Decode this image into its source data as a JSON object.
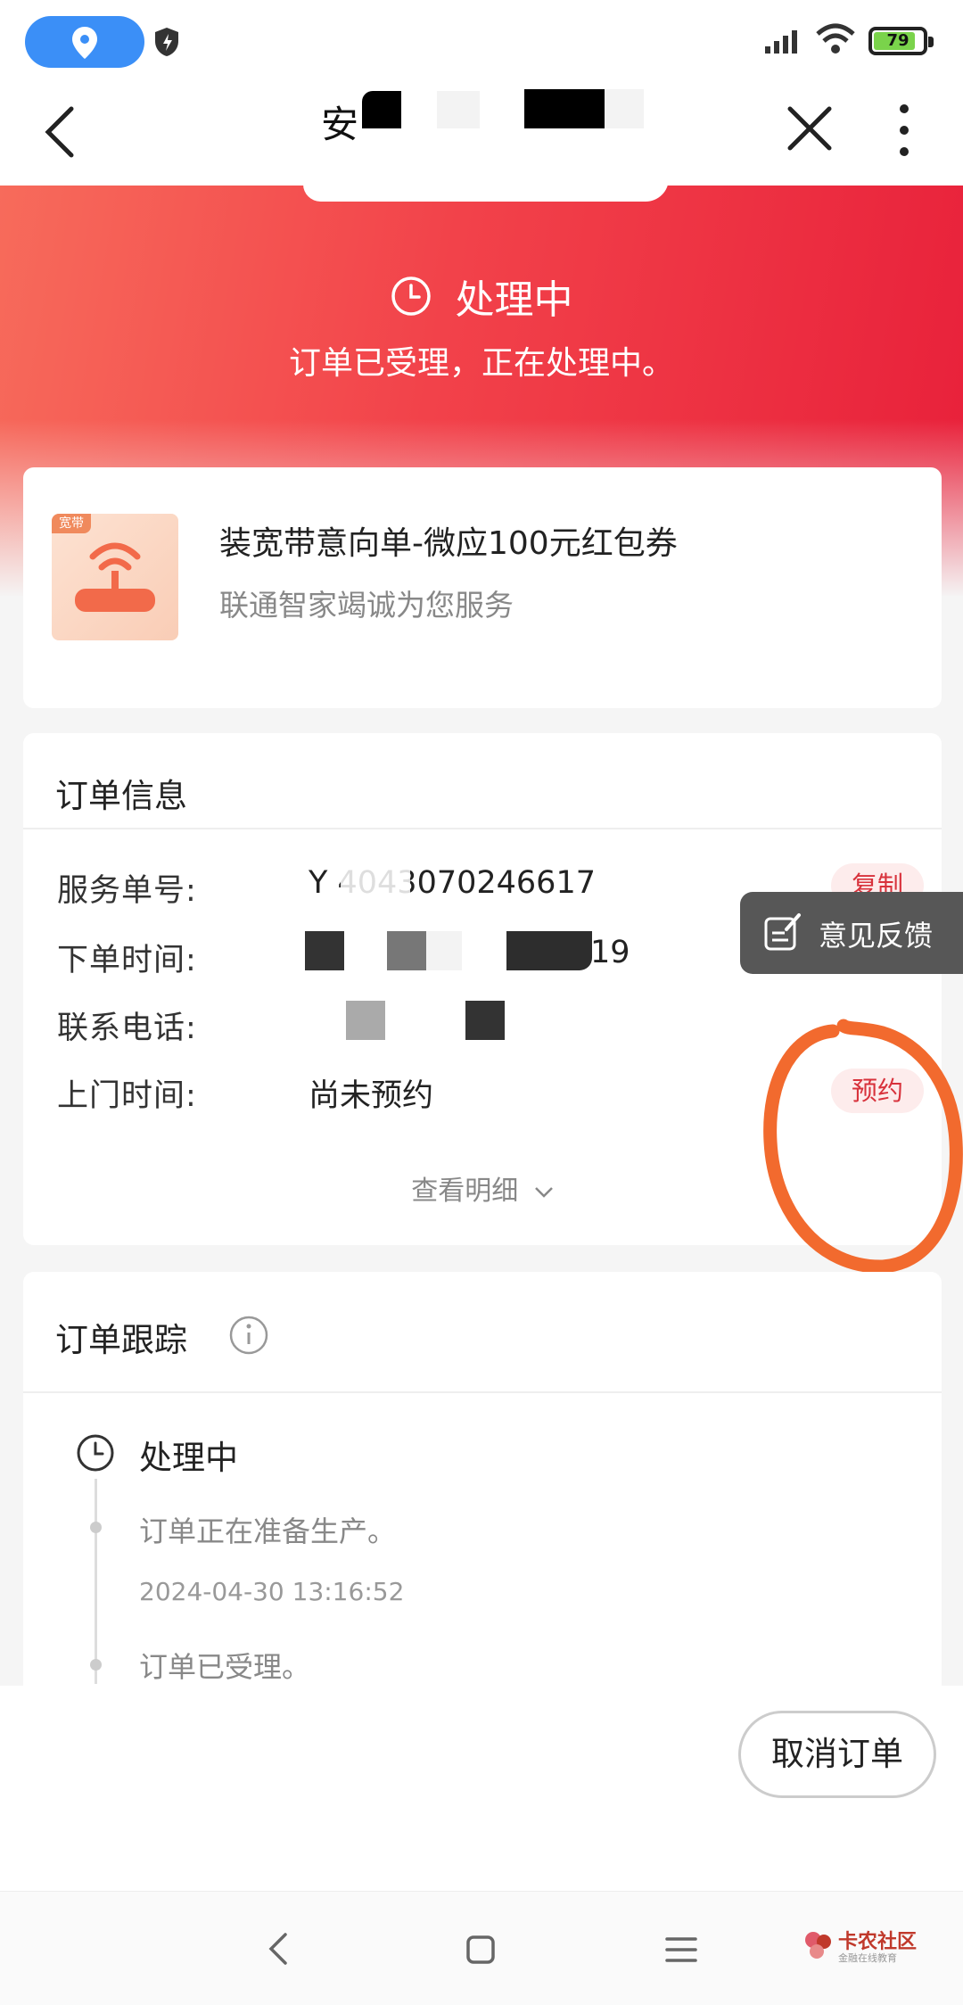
{
  "status_bar": {
    "battery": "79"
  },
  "header": {
    "title_partial": "安"
  },
  "hero": {
    "status_title": "处理中",
    "status_desc": "订单已受理，正在处理中。"
  },
  "product": {
    "tag": "宽带",
    "name": "装宽带意向单-微应100元红包券",
    "subtitle": "联通智家竭诚为您服务"
  },
  "order_info": {
    "title": "订单信息",
    "rows": [
      {
        "label": "服务单号:",
        "value": "Y    4043070246617",
        "action": "复制"
      },
      {
        "label": "下单时间:",
        "value": "19"
      },
      {
        "label": "联系电话:",
        "value": ""
      },
      {
        "label": "上门时间:",
        "value": "尚未预约",
        "action": "预约"
      }
    ],
    "detail_link": "查看明细"
  },
  "feedback": {
    "label": "意见反馈"
  },
  "tracking": {
    "title": "订单跟踪",
    "current_status": "处理中",
    "events": [
      {
        "text": "订单正在准备生产。",
        "time": "2024-04-30 13:16:52"
      },
      {
        "text": "订单已受理。"
      }
    ]
  },
  "actions": {
    "cancel": "取消订单"
  },
  "watermark": {
    "main": "卡农社区",
    "sub": "金融在线教育"
  },
  "colors": {
    "accent_red": "#e8203a",
    "hero_left": "#f76b5b",
    "annotation_orange": "#f26a2e",
    "pill_bg": "#fdecec"
  }
}
